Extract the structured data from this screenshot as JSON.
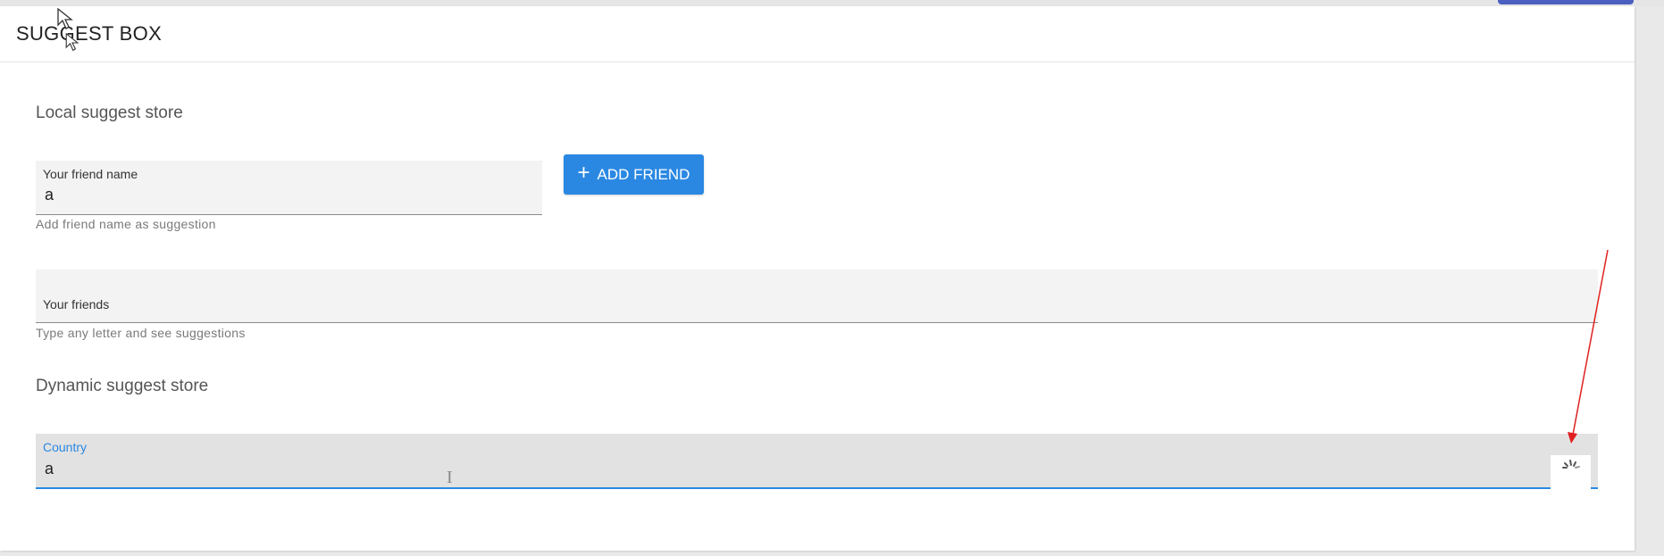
{
  "panel": {
    "title": "SUGGEST BOX"
  },
  "local_section": {
    "title": "Local suggest store",
    "friend_name_field": {
      "label": "Your friend name",
      "value": "a",
      "helper": "Add friend name as suggestion"
    },
    "add_button": {
      "icon": "plus-icon",
      "label": "ADD FRIEND"
    },
    "friends_field": {
      "label": "Your friends",
      "value": "",
      "helper": "Type any letter and see suggestions"
    }
  },
  "dynamic_section": {
    "title": "Dynamic suggest store",
    "country_field": {
      "label": "Country",
      "value": "a",
      "status_icon": "loading-spinner-icon"
    }
  },
  "colors": {
    "accent": "#2a88e3",
    "annotation_arrow": "#e02020"
  }
}
